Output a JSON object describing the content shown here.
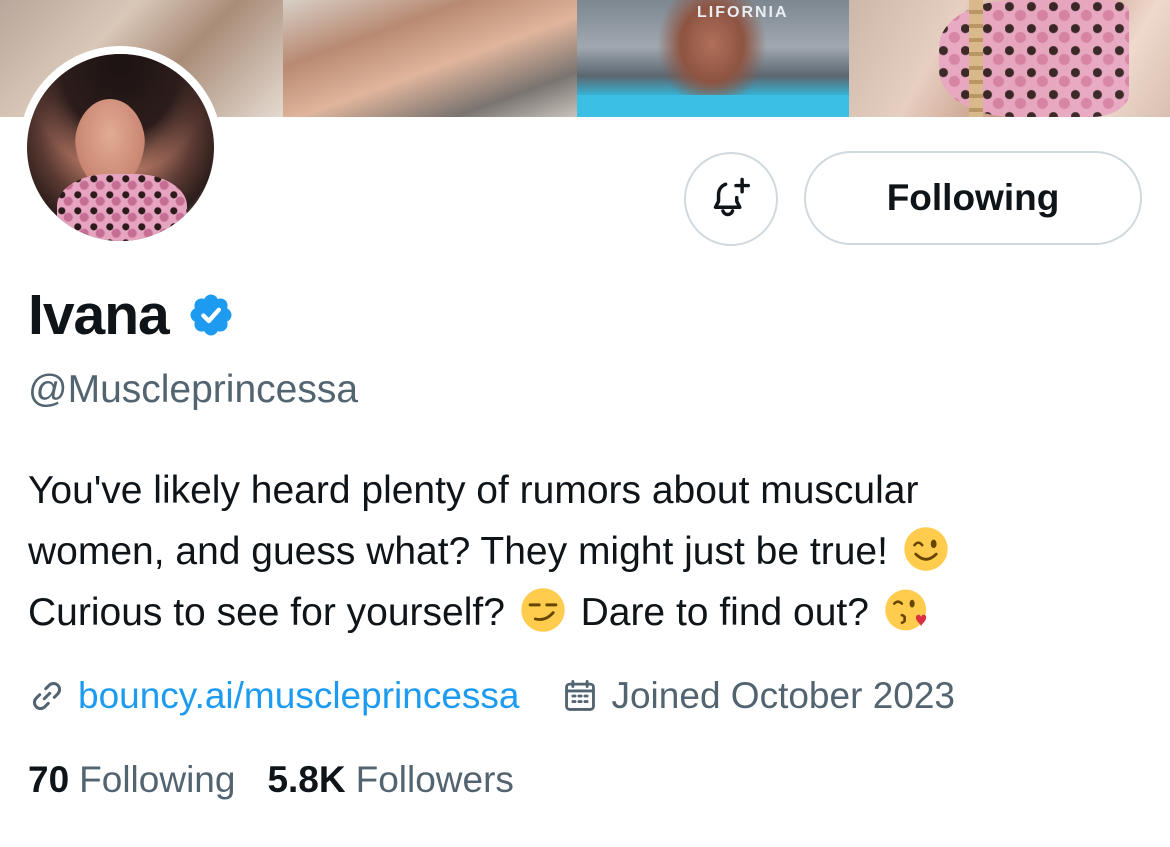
{
  "banner": {
    "tiles": [
      "banner-photo-1",
      "banner-photo-2",
      "banner-photo-3",
      "banner-photo-4"
    ],
    "stage_text": "LIFORNIA"
  },
  "profile": {
    "display_name": "Ivana",
    "verified": true,
    "handle": "@Muscleprincessa",
    "bio_lines": [
      "You've likely heard plenty of rumors about muscular",
      "women, and guess what? They might just be true!",
      "Curious to see for yourself?",
      "Dare to find out?"
    ],
    "bio_emojis": [
      "winking-face",
      "smirking-face",
      "face-blowing-kiss"
    ],
    "link": "bouncy.ai/muscleprincessa",
    "joined": "Joined October 2023"
  },
  "actions": {
    "notify_icon": "bell-plus-icon",
    "following_label": "Following"
  },
  "stats": {
    "following_count": "70",
    "following_label": "Following",
    "followers_count": "5.8K",
    "followers_label": "Followers"
  },
  "colors": {
    "text_primary": "#0f1419",
    "text_secondary": "#536471",
    "link": "#1d9bf0",
    "verified": "#1d9bf0",
    "border": "#cfd9de",
    "background": "#ffffff"
  }
}
